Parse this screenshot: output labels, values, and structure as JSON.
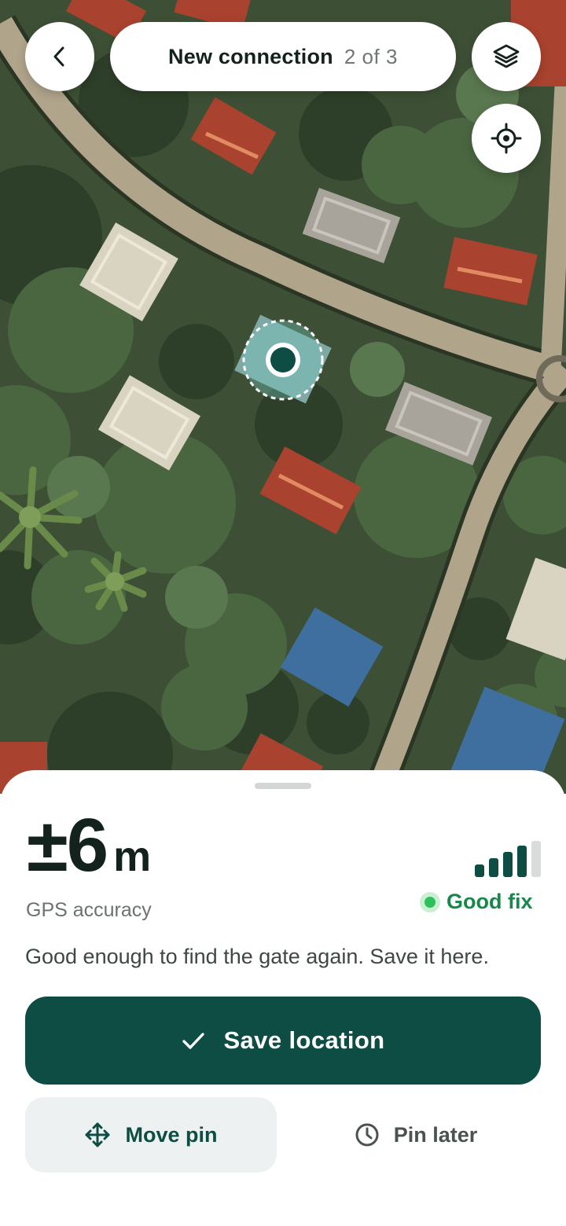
{
  "header": {
    "title": "New connection",
    "step": "2 of 3",
    "back_icon": "chevron-left-icon",
    "layers_icon": "layers-icon",
    "locate_icon": "crosshair-icon"
  },
  "map": {
    "pin_icon": "location-pin-icon"
  },
  "sheet": {
    "accuracy_value": "±6",
    "accuracy_unit": "m",
    "accuracy_label": "GPS accuracy",
    "signal_bars_filled": 4,
    "signal_bars_total": 5,
    "fix_status": "Good fix",
    "message": "Good enough to find the gate again. Save it here.",
    "save_label": "Save location",
    "move_label": "Move pin",
    "later_label": "Pin later"
  },
  "colors": {
    "primary": "#0d4d44",
    "fix_green": "#17874a",
    "map_ground": "#3d5035"
  }
}
